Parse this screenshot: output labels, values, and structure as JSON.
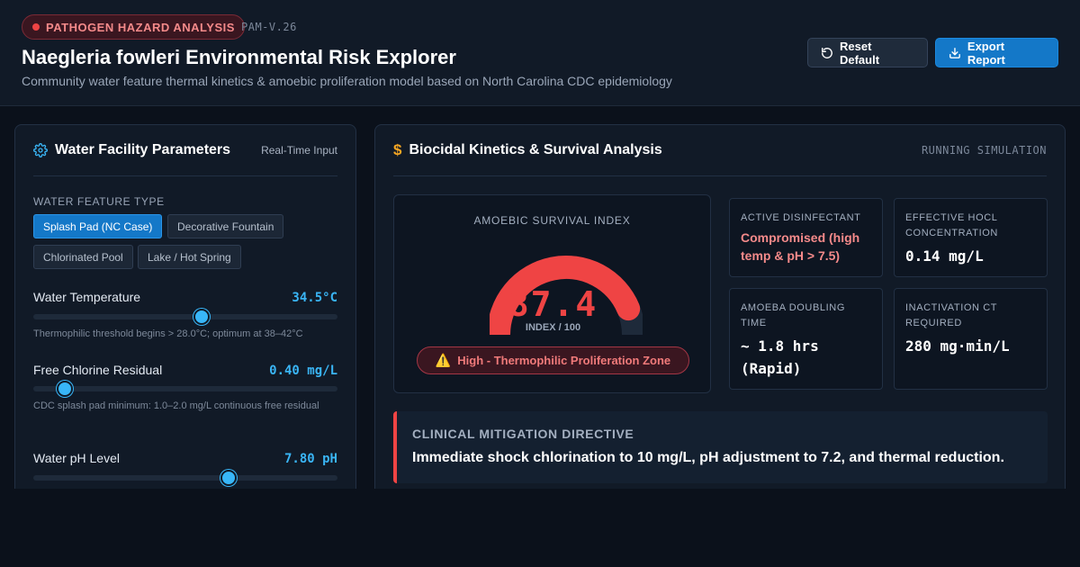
{
  "header": {
    "badge": "PATHOGEN HAZARD ANALYSIS",
    "version": "PAM-V.26",
    "title": "Naegleria fowleri Environmental Risk Explorer",
    "subtitle": "Community water feature thermal kinetics & amoebic proliferation model based on North Carolina CDC epidemiology",
    "reset_label": "Reset Default",
    "export_label": "Export Report",
    "reset_icon": "rotate-ccw-icon",
    "export_icon": "download-icon"
  },
  "left_panel": {
    "title": "Water Facility Parameters",
    "mode": "Real-Time Input",
    "icon": "gear-icon",
    "feature_type_label": "WATER FEATURE TYPE",
    "feature_types": [
      "Splash Pad (NC Case)",
      "Decorative Fountain",
      "Chlorinated Pool",
      "Lake / Hot Spring"
    ],
    "selected_feature": "Splash Pad (NC Case)",
    "params": [
      {
        "label": "Water Temperature",
        "value": "34.5°C",
        "level": 0.55,
        "note": "Thermophilic threshold begins > 28.0°C; optimum at 38–42°C"
      },
      {
        "label": "Free Chlorine Residual",
        "value": "0.40 mg/L",
        "level": 0.1,
        "note": "CDC splash pad minimum: 1.0–2.0 mg/L continuous free residual"
      },
      {
        "label": "Water pH Level",
        "value": "7.80 pH",
        "level": 0.64,
        "note": ""
      }
    ]
  },
  "right_panel": {
    "title": "Biocidal Kinetics & Survival Analysis",
    "status": "RUNNING SIMULATION",
    "icon": "dollar-icon",
    "gauge": {
      "title": "AMOEBIC SURVIVAL INDEX",
      "value": "87.4",
      "fraction": 0.874,
      "unit": "INDEX / 100",
      "zone": "High - Thermophilic Proliferation Zone",
      "zone_icon": "warning-icon"
    },
    "metrics": [
      {
        "label": "ACTIVE DISINFECTANT",
        "value": "Compromised (high temp & pH > 7.5)",
        "warn": true
      },
      {
        "label": "EFFECTIVE HOCL CONCENTRATION",
        "value": "0.14 mg/L",
        "warn": false
      },
      {
        "label": "AMOEBA DOUBLING TIME",
        "value": "~ 1.8 hrs (Rapid)",
        "warn": false
      },
      {
        "label": "INACTIVATION CT REQUIRED",
        "value": "280 mg·min/L",
        "warn": false
      }
    ],
    "directive": {
      "title": "CLINICAL MITIGATION DIRECTIVE",
      "text": "Immediate shock chlorination to 10 mg/L, pH adjustment to 7.2, and thermal reduction."
    }
  },
  "colors": {
    "accent": "#1478c8",
    "danger": "#ef4444",
    "value_blue": "#3ab5f5"
  }
}
